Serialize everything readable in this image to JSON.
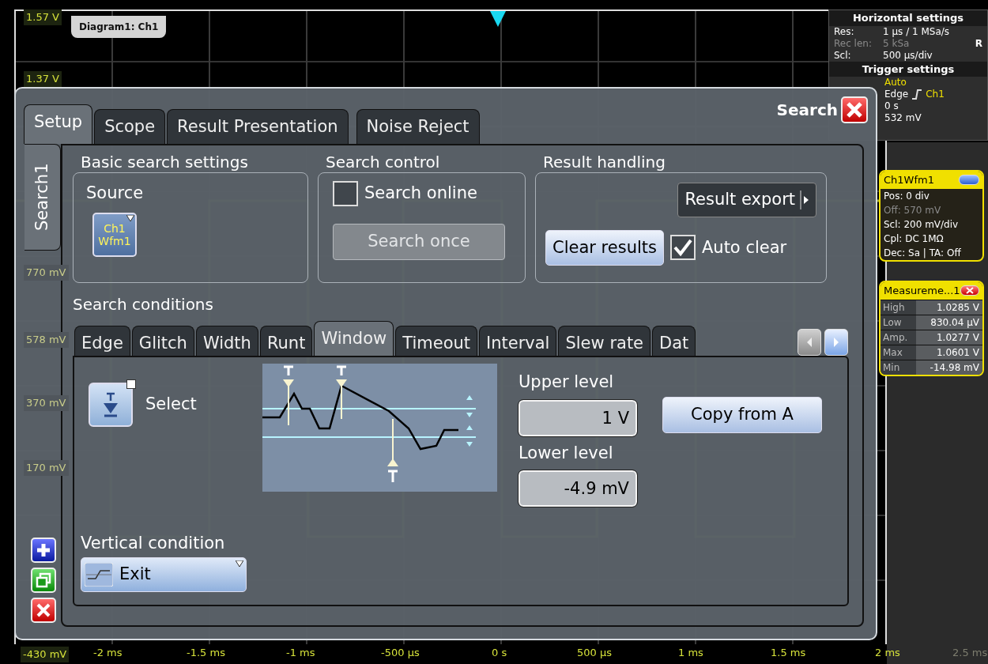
{
  "scope": {
    "diagram_tab": "Diagram1: Ch1",
    "y_labels": [
      {
        "text": "1.57 V",
        "dim": false
      },
      {
        "text": "1.37 V",
        "dim": false
      },
      {
        "text": "770 mV",
        "dim": true
      },
      {
        "text": "578 mV",
        "dim": true
      },
      {
        "text": "370 mV",
        "dim": true
      },
      {
        "text": "170 mV",
        "dim": true
      },
      {
        "text": "-430 mV",
        "dim": false
      }
    ],
    "x_labels": [
      {
        "text": "-2 ms",
        "dim": false
      },
      {
        "text": "-1.5 ms",
        "dim": false
      },
      {
        "text": "-1 ms",
        "dim": false
      },
      {
        "text": "-500 µs",
        "dim": false
      },
      {
        "text": "0 s",
        "dim": false
      },
      {
        "text": "500 µs",
        "dim": false
      },
      {
        "text": "1 ms",
        "dim": false
      },
      {
        "text": "1.5 ms",
        "dim": false
      },
      {
        "text": "2 ms",
        "dim": false
      },
      {
        "text": "2.5 ms",
        "dim": true
      }
    ]
  },
  "horizontal_settings": {
    "title": "Horizontal settings",
    "rows": [
      {
        "label": "Res:",
        "value": "1 µs / 1 MSa/s",
        "dim": false
      },
      {
        "label": "Rec len:",
        "value": "5 kSa",
        "dim": true,
        "column_3": "R"
      },
      {
        "label": "Scl:",
        "value": "500 µs/div",
        "dim": false
      }
    ]
  },
  "trigger_settings": {
    "title": "Trigger settings",
    "rows": [
      {
        "kind": "text",
        "value": "Auto",
        "highlight": true
      },
      {
        "kind": "edge",
        "value": "Edge",
        "source": "Ch1"
      },
      {
        "kind": "text",
        "value": "0 s",
        "highlight": false
      },
      {
        "kind": "text",
        "value": "532 mV",
        "highlight": false
      }
    ]
  },
  "waveform_panel": {
    "title": "Ch1Wfm1",
    "rows": [
      {
        "text": "Pos: 0 div",
        "dim": false
      },
      {
        "text": "Off: 570 mV",
        "dim": true
      },
      {
        "text": "Scl: 200 mV/div",
        "dim": false
      },
      {
        "text": "Cpl: DC 1MΩ",
        "dim": false
      },
      {
        "text": "Dec: Sa | TA: Off",
        "dim": false
      }
    ]
  },
  "measurement_panel": {
    "title": "Measureme...1",
    "rows": [
      {
        "label": "High",
        "value": "1.0285 V"
      },
      {
        "label": "Low",
        "value": "830.04 µV"
      },
      {
        "label": "Amp.",
        "value": "1.0277 V"
      },
      {
        "label": "Max",
        "value": "1.0601 V"
      },
      {
        "label": "Min",
        "value": "-14.98 mV"
      }
    ]
  },
  "dialog": {
    "title": "Search",
    "tabs": [
      {
        "label": "Setup",
        "selected": true
      },
      {
        "label": "Scope",
        "selected": false
      },
      {
        "label": "Result Presentation",
        "selected": false
      },
      {
        "label": "Noise Reject",
        "selected": false
      }
    ],
    "side_tabs": [
      {
        "label": "Search1",
        "selected": true
      }
    ],
    "basic": {
      "title": "Basic search settings",
      "source_label": "Source",
      "source_lines": [
        "Ch1",
        "Wfm1"
      ]
    },
    "control": {
      "title": "Search control",
      "online": {
        "label": "Search online",
        "checked": false
      },
      "once": {
        "label": "Search once",
        "disabled": true
      }
    },
    "results": {
      "title": "Result handling",
      "export": "Result export",
      "clear": "Clear results",
      "auto_clear": {
        "label": "Auto clear",
        "checked": true
      }
    },
    "conditions_title": "Search conditions",
    "condition_tabs": [
      {
        "label": "Edge",
        "selected": false
      },
      {
        "label": "Glitch",
        "selected": false
      },
      {
        "label": "Width",
        "selected": false
      },
      {
        "label": "Runt",
        "selected": false
      },
      {
        "label": "Window",
        "selected": true
      },
      {
        "label": "Timeout",
        "selected": false
      },
      {
        "label": "Interval",
        "selected": false
      },
      {
        "label": "Slew rate",
        "selected": false
      },
      {
        "label": "Dat",
        "selected": false
      }
    ],
    "select_label": "Select",
    "upper": {
      "label": "Upper level",
      "value": "1 V"
    },
    "lower": {
      "label": "Lower level",
      "value": "-4.9 mV"
    },
    "copy": "Copy from A",
    "vertical": {
      "label": "Vertical condition",
      "value": "Exit"
    }
  }
}
